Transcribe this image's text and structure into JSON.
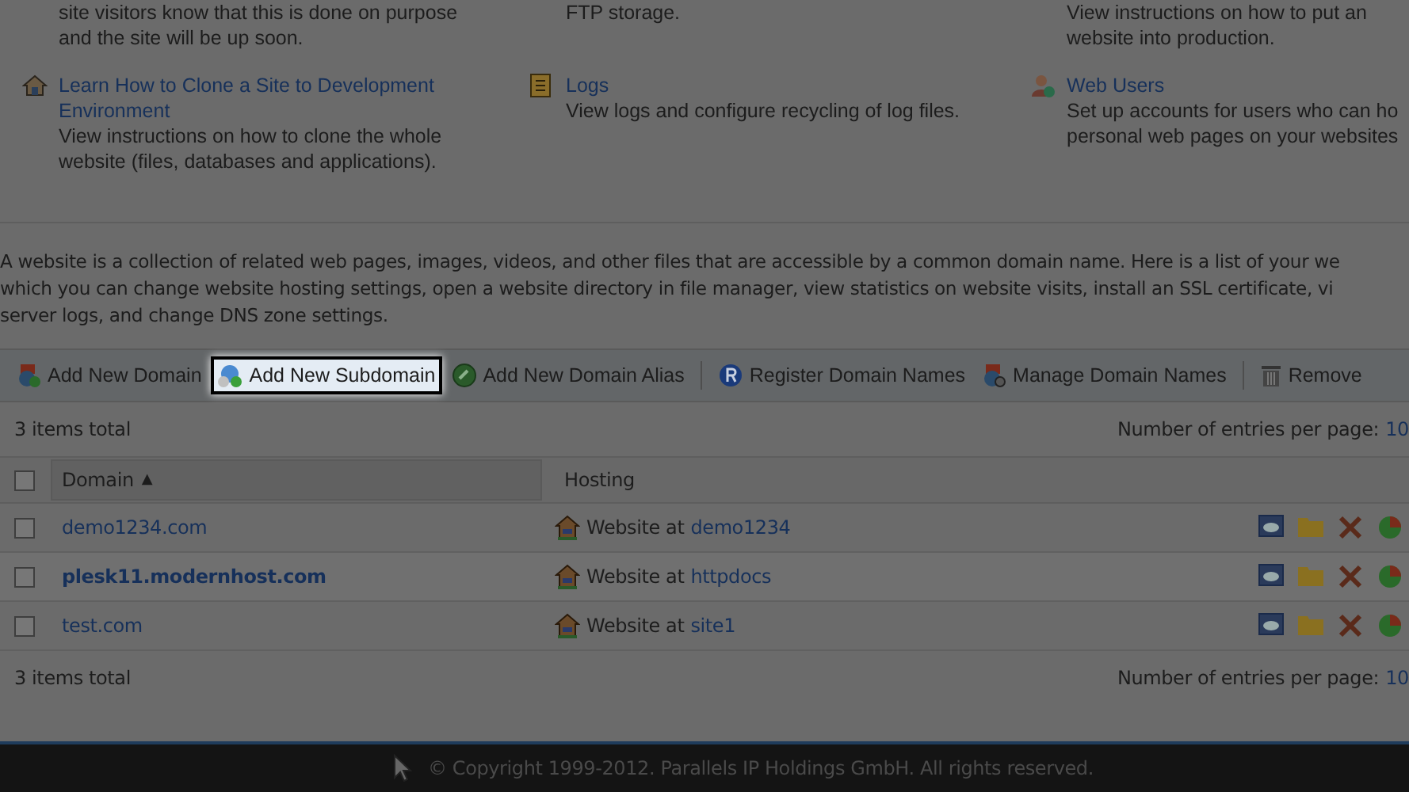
{
  "tools": [
    {
      "kind": "partial",
      "lines": [
        "site visitors know that this is done on purpose",
        "and the site will be up soon."
      ]
    },
    {
      "kind": "partial",
      "lines": [
        "FTP storage."
      ]
    },
    {
      "kind": "partial",
      "lines": [
        "View instructions on how to put an",
        "website into production."
      ]
    },
    {
      "kind": "clone",
      "title": "Learn How to Clone a Site to Development Environment",
      "lines": [
        "View instructions on how to clone the whole",
        "website (files, databases and applications)."
      ]
    },
    {
      "kind": "logs",
      "title": "Logs",
      "lines": [
        "View logs and configure recycling of log files."
      ]
    },
    {
      "kind": "users",
      "title": "Web Users",
      "lines": [
        "Set up accounts for users who can ho",
        "personal web pages on your websites"
      ]
    }
  ],
  "description": [
    "A website is a collection of related web pages, images, videos, and other files that are accessible by a common domain name. Here is a list of your we",
    "which you can change website hosting settings, open a website directory in file manager, view statistics on website visits, install an SSL certificate, vi",
    "server logs, and change DNS zone settings."
  ],
  "toolbar": [
    {
      "kind": "domain",
      "label": "Add New Domain",
      "selected": false
    },
    {
      "kind": "subdomain",
      "label": "Add New Subdomain",
      "selected": true
    },
    {
      "kind": "alias",
      "label": "Add New Domain Alias",
      "selected": false
    },
    {
      "kind": "register",
      "label": "Register Domain Names",
      "selected": false
    },
    {
      "kind": "manage",
      "label": "Manage Domain Names",
      "selected": false
    },
    {
      "kind": "remove",
      "label": "Remove",
      "selected": false
    }
  ],
  "list_top": {
    "total": "3 items total",
    "per_page_label": "Number of entries per page:",
    "per_page_value": "10"
  },
  "table": {
    "select_all_checked": false,
    "columns": [
      {
        "label": "Domain",
        "sort": "▲"
      },
      {
        "label": "Hosting"
      }
    ],
    "rows": [
      {
        "domain": "demo1234.com",
        "hosting_prefix": "Website at",
        "hosting_link": "demo1234",
        "checked": false
      },
      {
        "domain": "plesk11.modernhost.com",
        "hosting_prefix": "Website at",
        "hosting_link": "httpdocs",
        "checked": false
      },
      {
        "domain": "test.com",
        "hosting_prefix": "Website at",
        "hosting_link": "site1",
        "checked": false
      }
    ]
  },
  "list_bottom": {
    "total": "3 items total",
    "per_page_label": "Number of entries per page:",
    "per_page_value": "10"
  },
  "footer": {
    "copyright": "© Copyright 1999-2012. Parallels IP Holdings GmbH. All rights reserved."
  }
}
